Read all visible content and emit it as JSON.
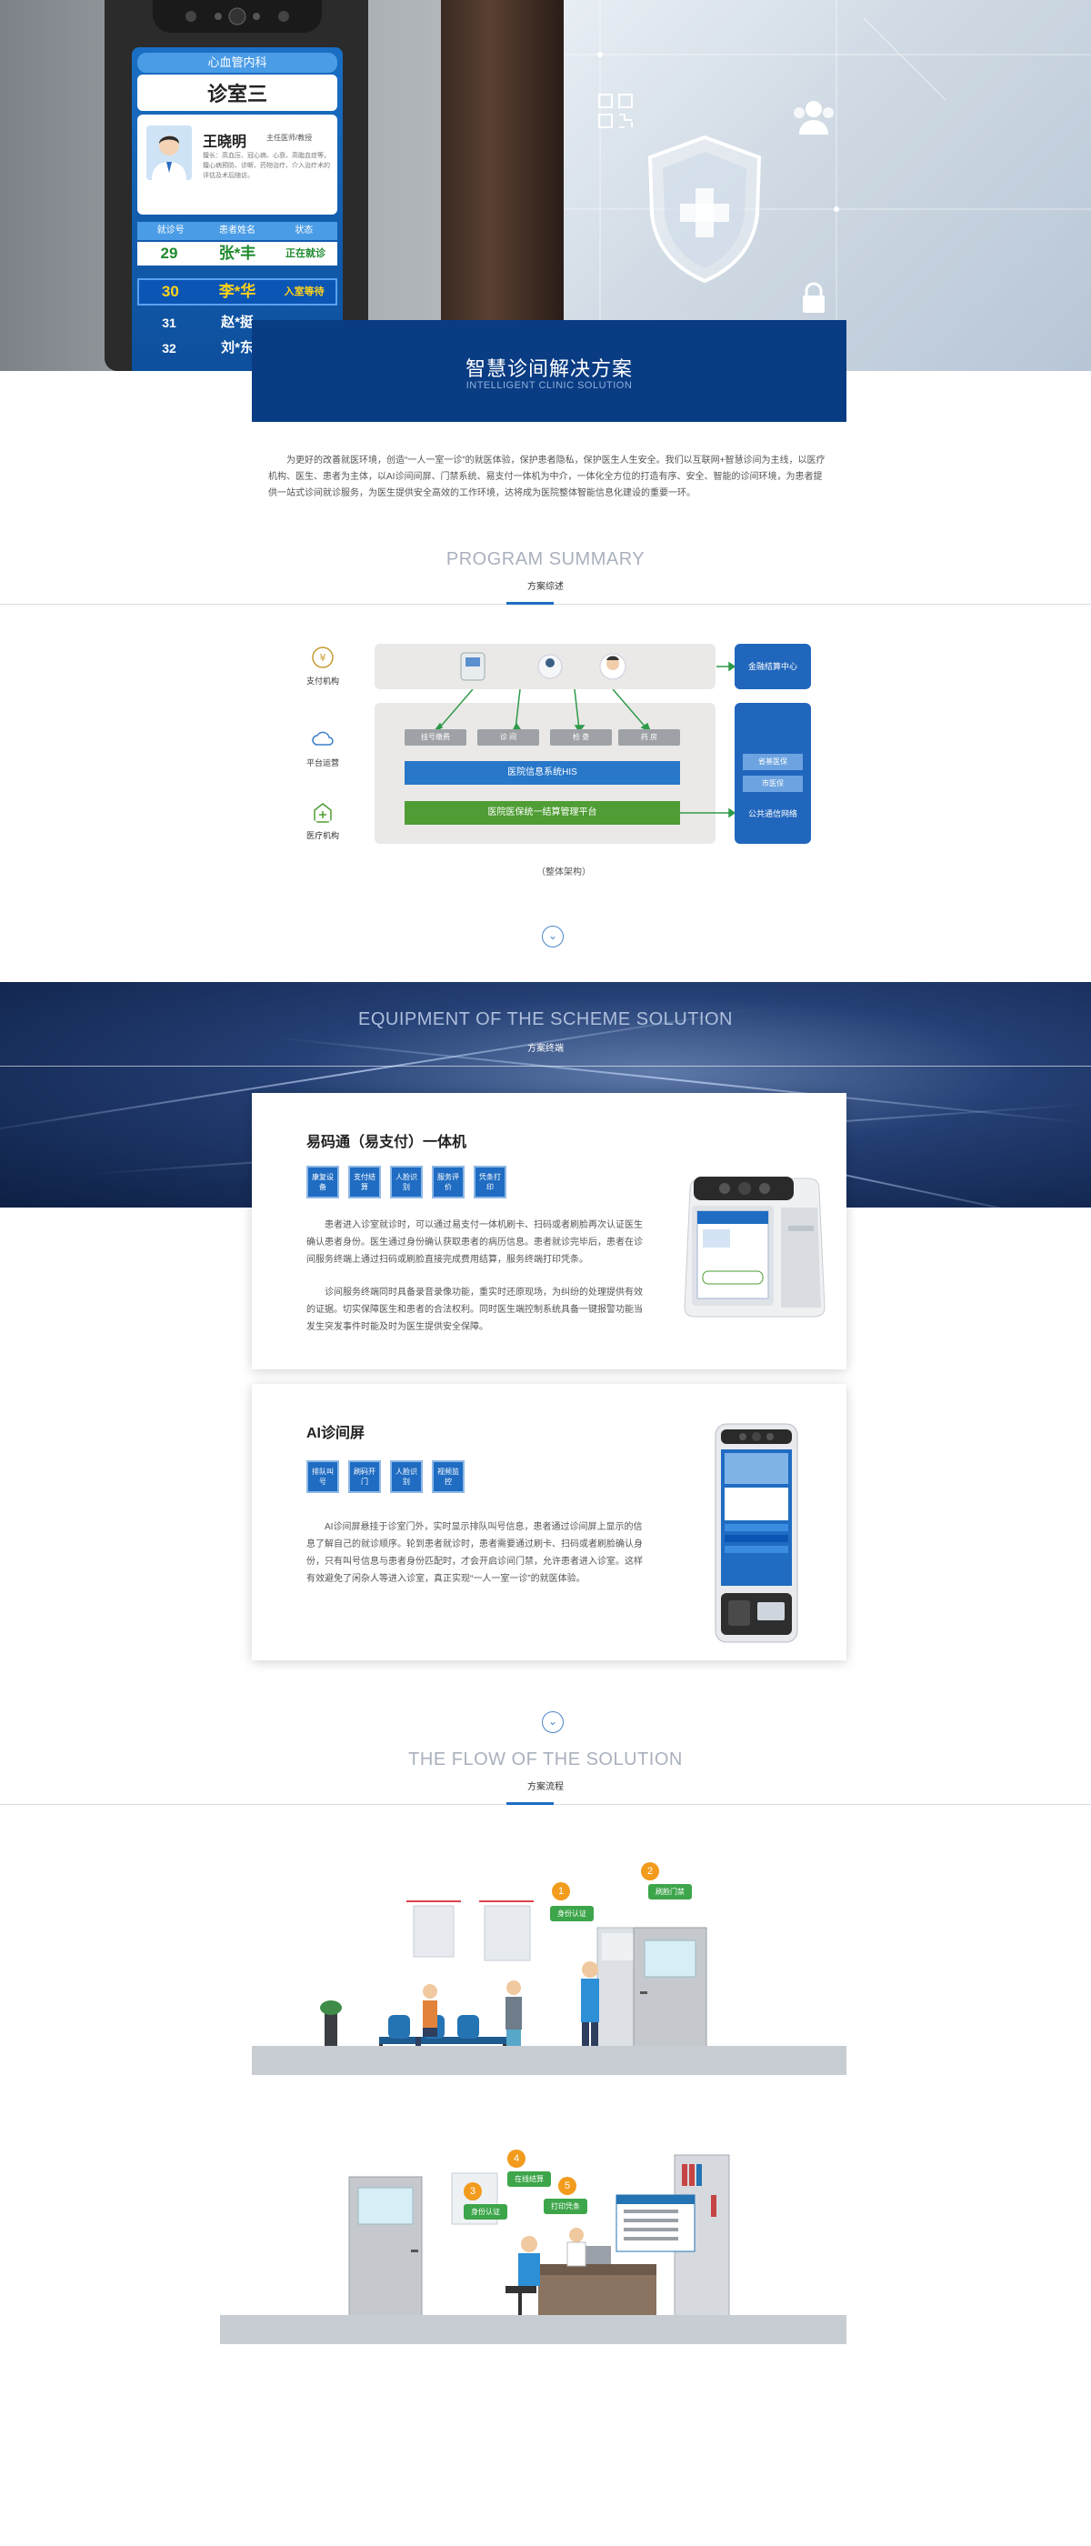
{
  "hero": {
    "screen": {
      "dept": "心血管内科",
      "room": "诊室三",
      "doctor_name": "王晓明",
      "doctor_title": "主任医师/教授",
      "doctor_desc": "擅长：高血压、冠心病、心衰、高脂血症等，擅心病预防、诊断、药物治疗、介入治疗术的评估及术后随访。",
      "table_headers": [
        "就诊号",
        "患者姓名",
        "状态"
      ],
      "rows": [
        {
          "num": "29",
          "name": "张*丰",
          "status": "正在就诊"
        },
        {
          "num": "30",
          "name": "李*华",
          "status": "入室等待"
        },
        {
          "num": "31",
          "name": "赵*挺",
          "status": ""
        },
        {
          "num": "32",
          "name": "刘*东",
          "status": ""
        }
      ]
    }
  },
  "title": {
    "cn": "智慧诊间解决方案",
    "en": "INTELLIGENT CLINIC SOLUTION"
  },
  "intro": "为更好的改善就医环境，创造“一人一室一诊”的就医体验，保护患者隐私，保护医生人生安全。我们以互联网+智慧诊间为主线，以医疗机构、医生、患者为主体，以AI诊间间屏、门禁系统、易支付一体机为中介，一体化全方位的打造有序、安全、智能的诊间环境，为患者提供一站式诊间就诊服务，为医生提供安全高效的工作环境，达将成为医院整体智能信息化建设的重要一环。",
  "summary": {
    "en": "PROGRAM SUMMARY",
    "cn": "方案综述"
  },
  "architecture": {
    "side_labels": [
      "支付机构",
      "平台运营",
      "医疗机构"
    ],
    "chips": [
      "挂号缴费",
      "诊  间",
      "检  查",
      "药  房"
    ],
    "his": "医院信息系统HIS",
    "insurance": "医院医保统一结算管理平台",
    "bank": "金融结算中心",
    "pub_chips": [
      "省基医保",
      "市医保"
    ],
    "pub_label": "公共通信网络",
    "caption": "（整体架构）"
  },
  "equipment": {
    "en": "EQUIPMENT OF THE SCHEME SOLUTION",
    "cn": "方案终端"
  },
  "cards": [
    {
      "title": "易码通（易支付）一体机",
      "tags": [
        "康复设备",
        "支付结算",
        "人脸识别",
        "服务评价",
        "凭条打印"
      ],
      "paragraphs": [
        "患者进入诊室就诊时，可以通过易支付一体机刷卡、扫码或者刷脸再次认证医生确认患者身份。医生通过身份确认获取患者的病历信息。患者就诊完毕后，患者在诊间服务终端上通过扫码或刷脸直接完成费用结算，服务终端打印凭条。",
        "诊间服务终端同时具备录音录像功能，重实时还原现场，为纠纷的处理提供有效的证据。切实保障医生和患者的合法权利。同时医生端控制系统具备一键报警功能当发生突发事件时能及时为医生提供安全保障。"
      ]
    },
    {
      "title": "AI诊间屏",
      "tags": [
        "排队叫号",
        "刷码开门",
        "人脸识别",
        "视频监控"
      ],
      "paragraphs": [
        "AI诊间屏悬挂于诊室门外，实时显示排队叫号信息，患者通过诊间屏上显示的信息了解自己的就诊顺序。轮到患者就诊时，患者需要通过刷卡、扫码或者刷脸确认身份，只有叫号信息与患者身份匹配时，才会开启诊间门禁，允许患者进入诊室。这样有效避免了闲杂人等进入诊室，真正实现“一人一室一诊”的就医体验。"
      ]
    }
  ],
  "flow": {
    "en": "THE FLOW OF THE SOLUTION",
    "cn": "方案流程",
    "scene1_badges": [
      {
        "num": "1",
        "label": "身份认证"
      },
      {
        "num": "2",
        "label": "刷脸门禁"
      }
    ],
    "scene2_badges": [
      {
        "num": "3",
        "label": "身份认证"
      },
      {
        "num": "4",
        "label": "在线结算"
      },
      {
        "num": "5",
        "label": "打印凭条"
      }
    ]
  },
  "colors": {
    "primary": "#0a3c83",
    "accent": "#1f6cc2",
    "green": "#4f9d34",
    "orange": "#f29b1d"
  }
}
